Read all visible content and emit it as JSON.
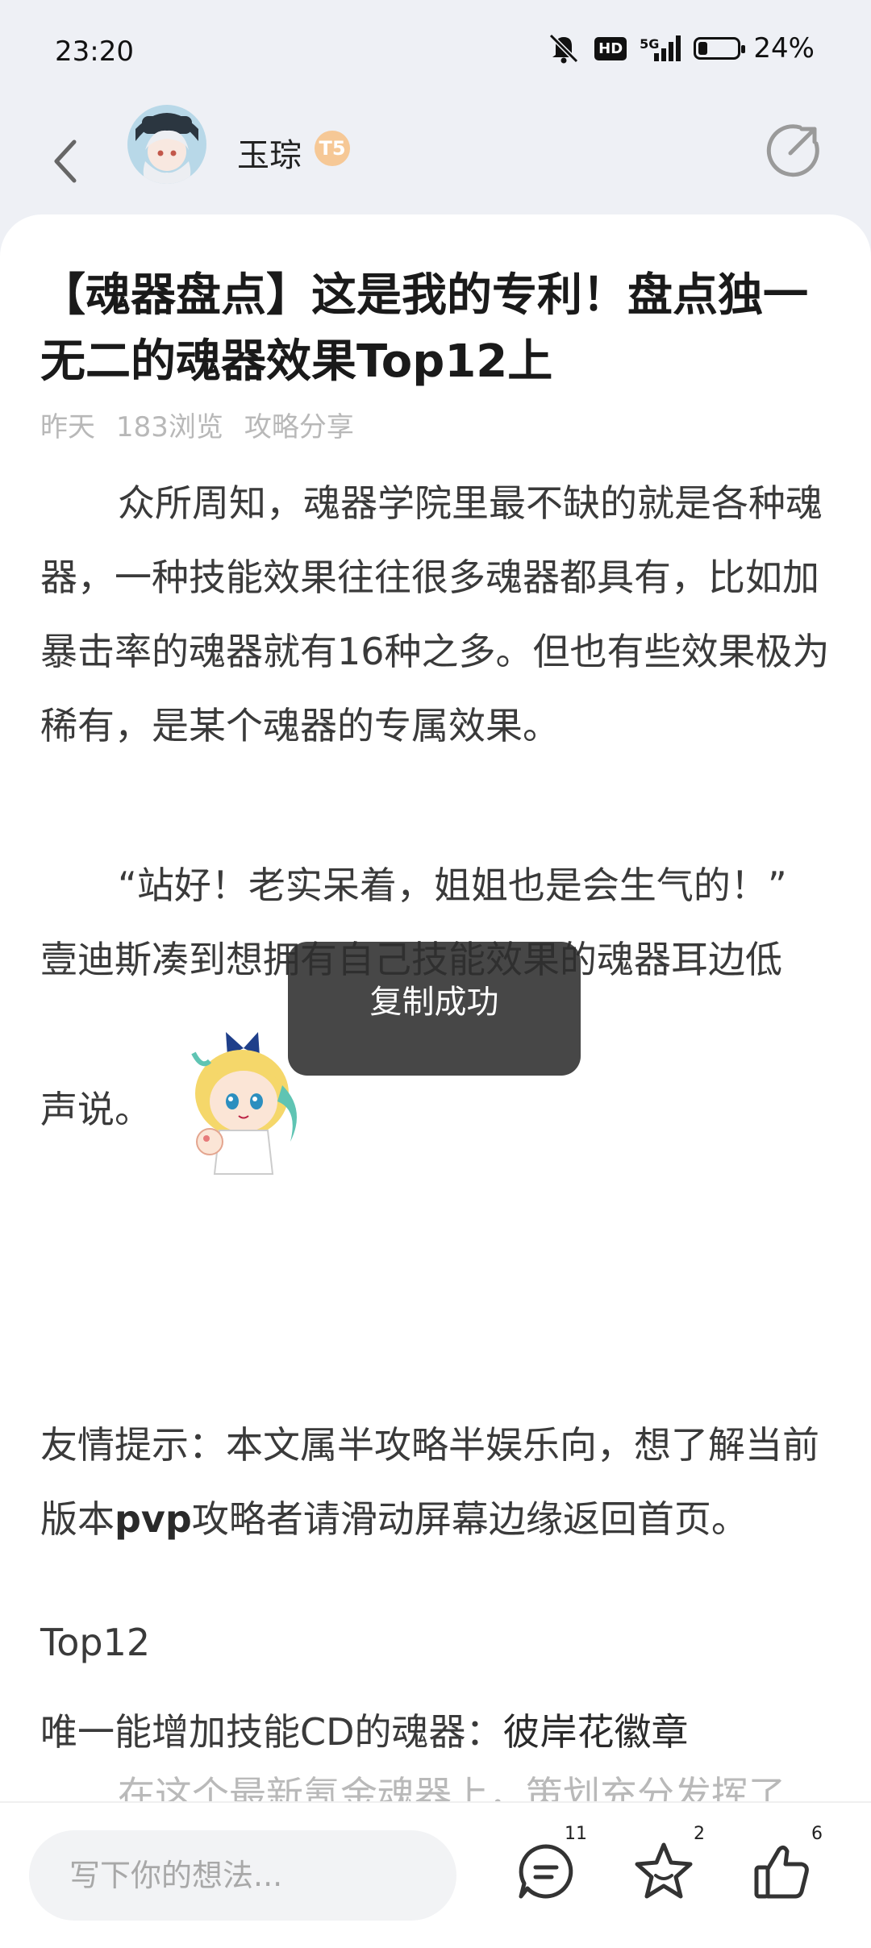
{
  "status_bar": {
    "time": "23:20",
    "network": "5G",
    "hd": "HD",
    "battery": "24%",
    "battery_level": 0.24
  },
  "header": {
    "username": "玉琮",
    "level": "T5"
  },
  "article": {
    "title": "【魂器盘点】这是我的专利！盘点独一无二的魂器效果Top12上",
    "meta": {
      "date": "昨天",
      "views": "183浏览",
      "category": "攻略分享"
    },
    "para1": "众所周知，魂器学院里最不缺的就是各种魂器，一种技能效果往往很多魂器都具有，比如加暴击率的魂器就有16种之多。但也有些效果极为稀有，是某个魂器的专属效果。",
    "para2_line1": "“站好！老实呆着，姐姐也是会生气的！”",
    "para2_line2": "壹迪斯凑到想拥有自己技能效果的魂器耳边低",
    "para2_line3": "声说。",
    "tip_part1": "友情提示：本文属半攻略半娱乐向，想了解当前版本",
    "tip_bold": "pvp",
    "tip_part2": "攻略者请滑动屏幕边缘返回首页。",
    "section_title": "Top12",
    "item_prefix": "唯一能增加技能CD的魂器：",
    "item_name": "彼岸花徽章",
    "faded_line": "在这个最新氪金魂器上，策划充分发挥了"
  },
  "toast": {
    "text": "复制成功"
  },
  "bottom_bar": {
    "input_placeholder": "写下你的想法...",
    "comment_count": "11",
    "favorite_count": "2",
    "like_count": "6"
  }
}
